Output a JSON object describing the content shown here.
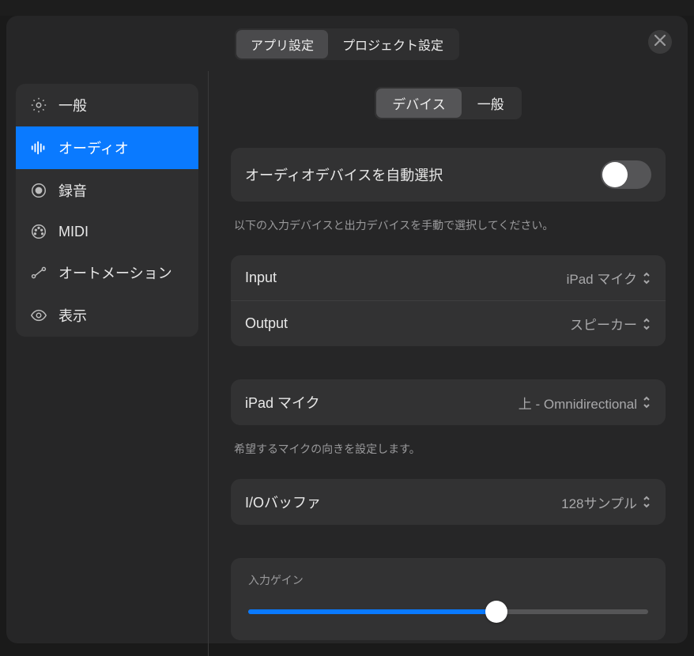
{
  "tabs": {
    "app": "アプリ設定",
    "project": "プロジェクト設定",
    "active": "app"
  },
  "sidebar": {
    "items": [
      {
        "id": "general",
        "label": "一般",
        "icon": "gear"
      },
      {
        "id": "audio",
        "label": "オーディオ",
        "icon": "waveform",
        "active": true
      },
      {
        "id": "record",
        "label": "録音",
        "icon": "record"
      },
      {
        "id": "midi",
        "label": "MIDI",
        "icon": "midi"
      },
      {
        "id": "automation",
        "label": "オートメーション",
        "icon": "automation"
      },
      {
        "id": "display",
        "label": "表示",
        "icon": "eye"
      }
    ]
  },
  "main": {
    "subtabs": {
      "device": "デバイス",
      "general": "一般",
      "active": "device"
    },
    "auto_select": {
      "label": "オーディオデバイスを自動選択",
      "value": false,
      "caption": "以下の入力デバイスと出力デバイスを手動で選択してください。"
    },
    "input": {
      "label": "Input",
      "value": "iPad マイク"
    },
    "output": {
      "label": "Output",
      "value": "スピーカー"
    },
    "mic": {
      "label": "iPad マイク",
      "value": "上 - Omnidirectional",
      "caption": "希望するマイクの向きを設定します。"
    },
    "io_buffer": {
      "label": "I/Oバッファ",
      "value": "128サンプル"
    },
    "input_gain": {
      "label": "入力ゲイン",
      "value": 62
    }
  },
  "colors": {
    "accent": "#0a7aff"
  }
}
